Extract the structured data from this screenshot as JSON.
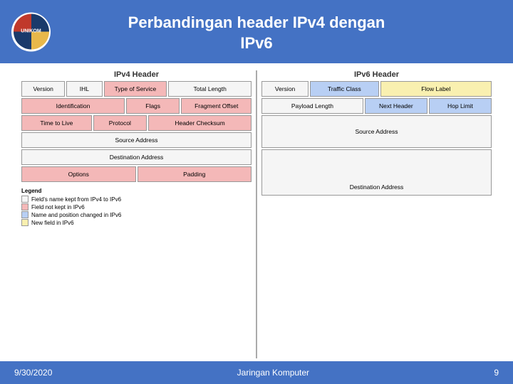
{
  "header": {
    "title_line1": "Perbandingan header IPv4 dengan",
    "title_line2": "IPv6",
    "logo_alt": "UNIKOM Logo"
  },
  "ipv4": {
    "section_title": "IPv4 Header",
    "rows": [
      [
        {
          "label": "Version",
          "color": "white",
          "flex": 1
        },
        {
          "label": "IHL",
          "color": "white",
          "flex": 1
        },
        {
          "label": "Type of Service",
          "color": "pink",
          "flex": 1.5
        },
        {
          "label": "Total Length",
          "color": "white",
          "flex": 2
        }
      ],
      [
        {
          "label": "Identification",
          "color": "pink",
          "flex": 3
        },
        {
          "label": "Flags",
          "color": "pink",
          "flex": 1.5
        },
        {
          "label": "Fragment Offset",
          "color": "pink",
          "flex": 2
        }
      ],
      [
        {
          "label": "Time to Live",
          "color": "pink",
          "flex": 2
        },
        {
          "label": "Protocol",
          "color": "pink",
          "flex": 1.5
        },
        {
          "label": "Header Checksum",
          "color": "pink",
          "flex": 3
        }
      ],
      [
        {
          "label": "Source Address",
          "color": "white",
          "flex": 1
        }
      ],
      [
        {
          "label": "Destination Address",
          "color": "white",
          "flex": 1
        }
      ],
      [
        {
          "label": "Options",
          "color": "pink",
          "flex": 2
        },
        {
          "label": "Padding",
          "color": "pink",
          "flex": 2
        }
      ]
    ]
  },
  "ipv6": {
    "section_title": "IPv6 Header",
    "rows": [
      [
        {
          "label": "Version",
          "color": "white",
          "flex": 1
        },
        {
          "label": "Traffic Class",
          "color": "blue",
          "flex": 1.5
        },
        {
          "label": "Flow Label",
          "color": "yellow",
          "flex": 2.5
        }
      ],
      [
        {
          "label": "Payload Length",
          "color": "white",
          "flex": 2.5
        },
        {
          "label": "Next Header",
          "color": "blue",
          "flex": 1.5
        },
        {
          "label": "Hop Limit",
          "color": "blue",
          "flex": 1.5
        }
      ],
      [
        {
          "label": "Source Address",
          "color": "white",
          "flex": 1,
          "tall": true
        }
      ],
      [
        {
          "label": "Destination Address",
          "color": "white",
          "flex": 1,
          "tall": true
        }
      ]
    ]
  },
  "legend": {
    "title": "Legend",
    "items": [
      {
        "color": "white",
        "label": "Field's name kept from IPv4 to IPv6"
      },
      {
        "color": "pink",
        "label": "Field not kept in IPv6"
      },
      {
        "color": "blue",
        "label": "Name and position changed in IPv6"
      },
      {
        "color": "yellow",
        "label": "New field in IPv6"
      }
    ]
  },
  "footer": {
    "date": "9/30/2020",
    "center": "Jaringan Komputer",
    "page": "9"
  }
}
